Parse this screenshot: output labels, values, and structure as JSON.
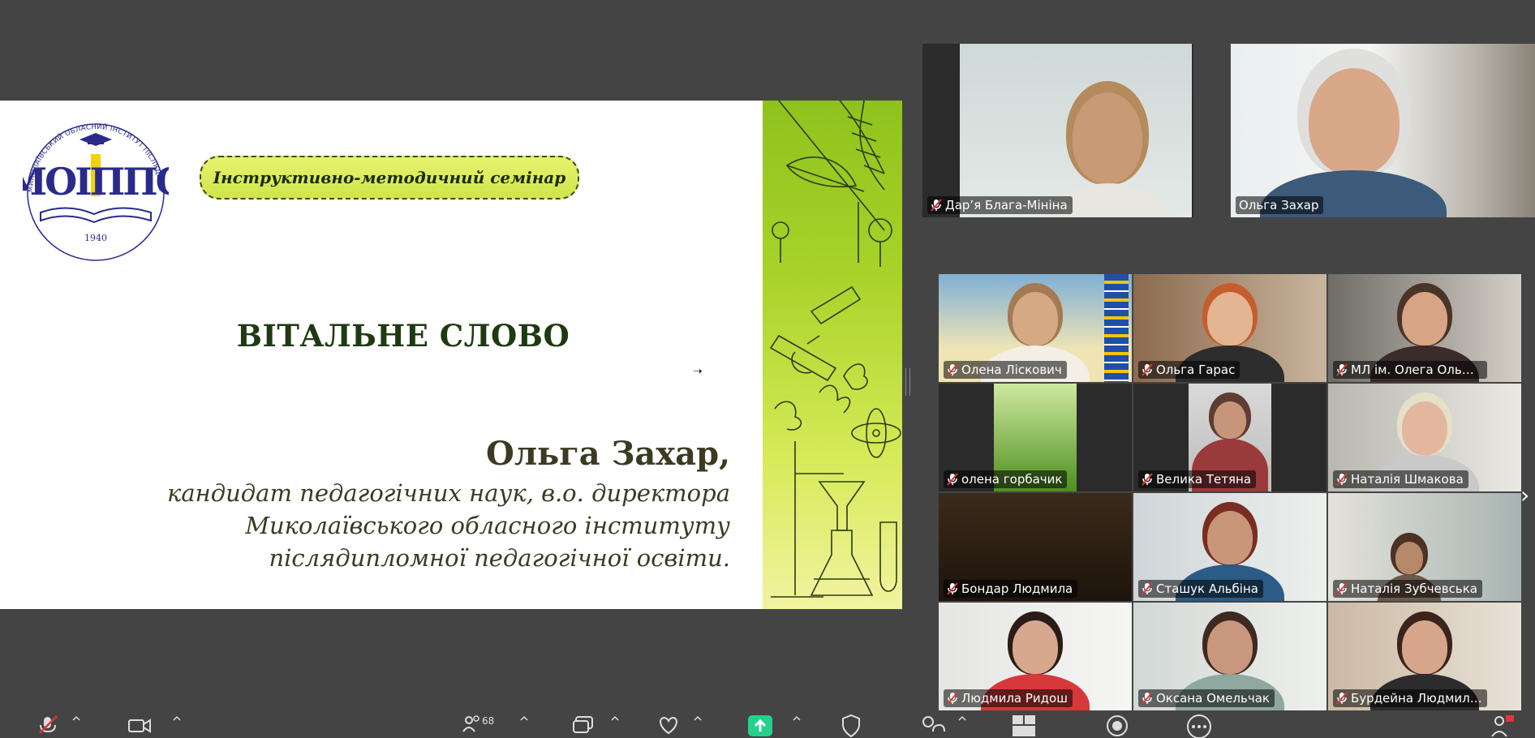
{
  "slide": {
    "logo_text": "МОІППО",
    "logo_year": "1940",
    "logo_ring_text": "МИКОЛАЇВСЬКИЙ ОБЛАСНИЙ ІНСТИТУТ ПІСЛЯДИПЛОМНОЇ ПЕДАГОГІЧНОЇ ОСВІТИ",
    "seminar_label": "Інструктивно-методичний семінар",
    "title": "ВІТАЛЬНЕ СЛОВО",
    "speaker_name": "Ольга Захар,",
    "speaker_line1": "кандидат педагогічних наук, в.о. директора",
    "speaker_line2": "Миколаївського обласного інституту",
    "speaker_line3": "післядипломної педагогічної освіти."
  },
  "top_tiles": [
    {
      "name": "Дар’я Блага-Мініна"
    },
    {
      "name": "Ольга Захар"
    }
  ],
  "gallery": [
    {
      "name": "Олена Ліскович"
    },
    {
      "name": "Ольга Гарас"
    },
    {
      "name": "МЛ ім. Олега Ольжи..."
    },
    {
      "name": "олена горбачик"
    },
    {
      "name": "Велика Тетяна"
    },
    {
      "name": "Наталія Шмакова"
    },
    {
      "name": "Бондар Людмила"
    },
    {
      "name": "Сташук Альбіна"
    },
    {
      "name": "Наталія Зубчевська"
    },
    {
      "name": "Людмила Ридош"
    },
    {
      "name": "Оксана Омельчак"
    },
    {
      "name": "Бурдейна Людмила ..."
    }
  ],
  "toolbar": {
    "participants_count": "68"
  },
  "colors": {
    "active_speaker": "#23d18b",
    "muted_mic": "#e0353a",
    "share_button": "#23d18b"
  }
}
